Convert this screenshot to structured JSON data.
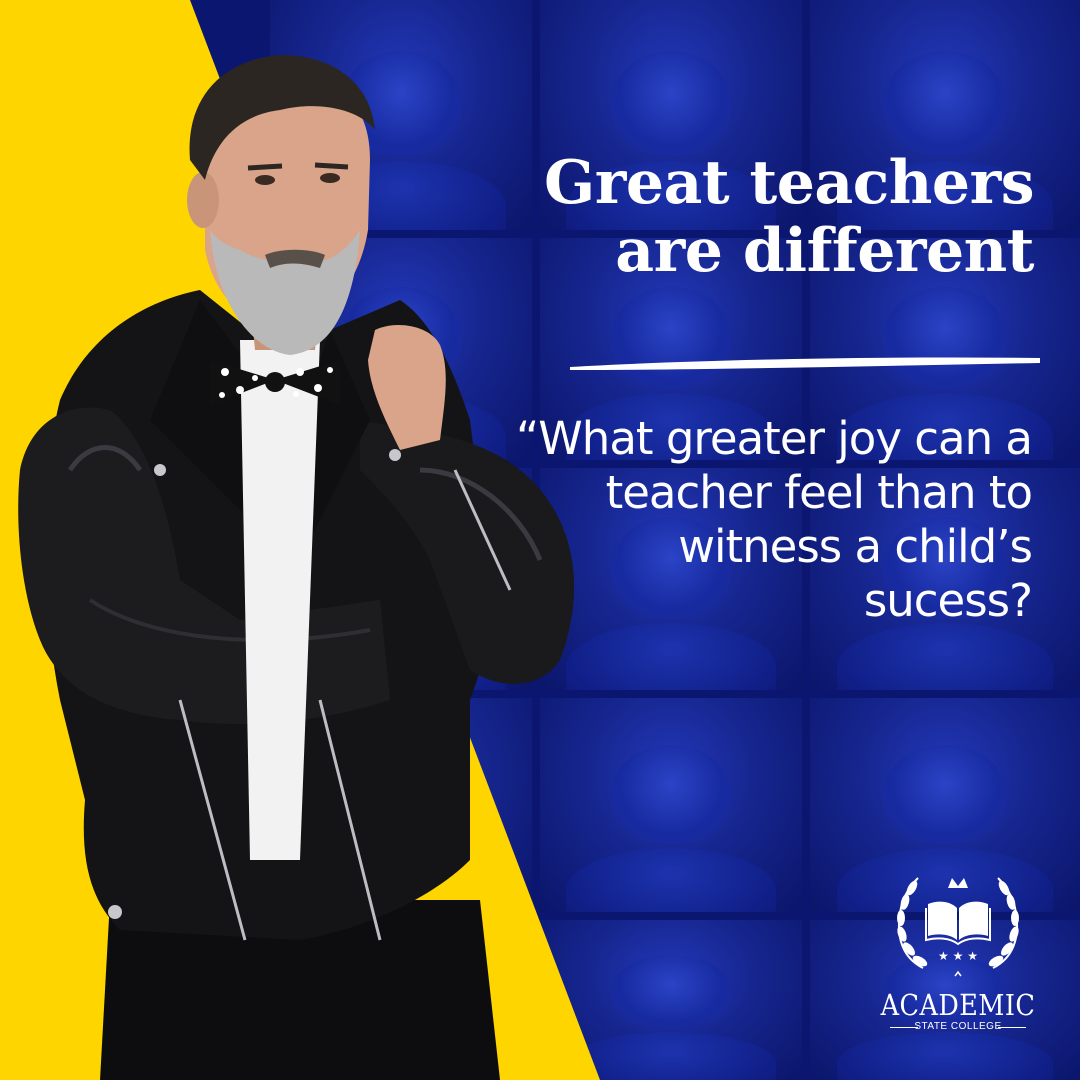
{
  "headline": {
    "line1": "Great teachers",
    "line2": "are different"
  },
  "quote": {
    "line1": "“What greater joy can a",
    "line2": "teacher feel than to",
    "line3": "witness a child’s",
    "line4": "sucess?"
  },
  "logo": {
    "name": "ACADEMIC",
    "subtitle": "STATE COLLEGE",
    "icon": "open-book-laurel-crown-icon"
  },
  "colors": {
    "yellow": "#ffd500",
    "blue": "#0a1670",
    "text": "#ffffff"
  }
}
